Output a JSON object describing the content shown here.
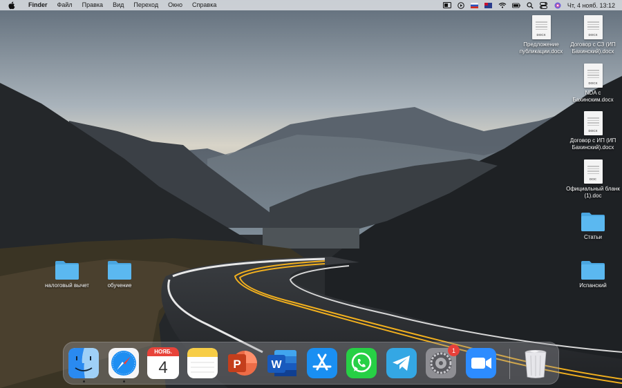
{
  "menubar": {
    "app_name": "Finder",
    "menus": [
      "Файл",
      "Правка",
      "Вид",
      "Переход",
      "Окно",
      "Справка"
    ],
    "clock": "Чт, 4 нояб.  13:12",
    "status_icons": [
      "screen-icon",
      "play-icon",
      "flag-icon",
      "flag-icon",
      "wifi-icon",
      "battery-icon",
      "search-icon",
      "control-center-icon",
      "siri-icon"
    ]
  },
  "desktop": {
    "files": [
      {
        "name": "Предложение публикации.docx",
        "ext": "DOCX"
      },
      {
        "name": "Договор с СЗ (ИП Бахинский).docx",
        "ext": "DOCX"
      },
      {
        "name": "NDA с Бахинским.docx",
        "ext": "DOCX"
      },
      {
        "name": "Договор с ИП (ИП Бахинский).docx",
        "ext": "DOCX"
      },
      {
        "name": "Официальный бланк (1).doc",
        "ext": "DOC"
      }
    ],
    "folders": [
      {
        "name": "Статьи"
      },
      {
        "name": "Испанский"
      },
      {
        "name": "налоговый вычет"
      },
      {
        "name": "обучение"
      }
    ]
  },
  "dock": {
    "apps": [
      "Finder",
      "Safari",
      "Календарь",
      "Заметки",
      "PowerPoint",
      "Word",
      "App Store",
      "WhatsApp",
      "Telegram",
      "Системные настройки",
      "Zoom",
      "Корзина"
    ],
    "calendar_month": "НОЯБ.",
    "calendar_day": "4",
    "settings_badge": "1",
    "powerpoint_letter": "P",
    "word_letter": "W"
  },
  "colors": {
    "folder": "#5bb8f0",
    "badge": "#e8403a",
    "road_line": "#f2b01e"
  }
}
